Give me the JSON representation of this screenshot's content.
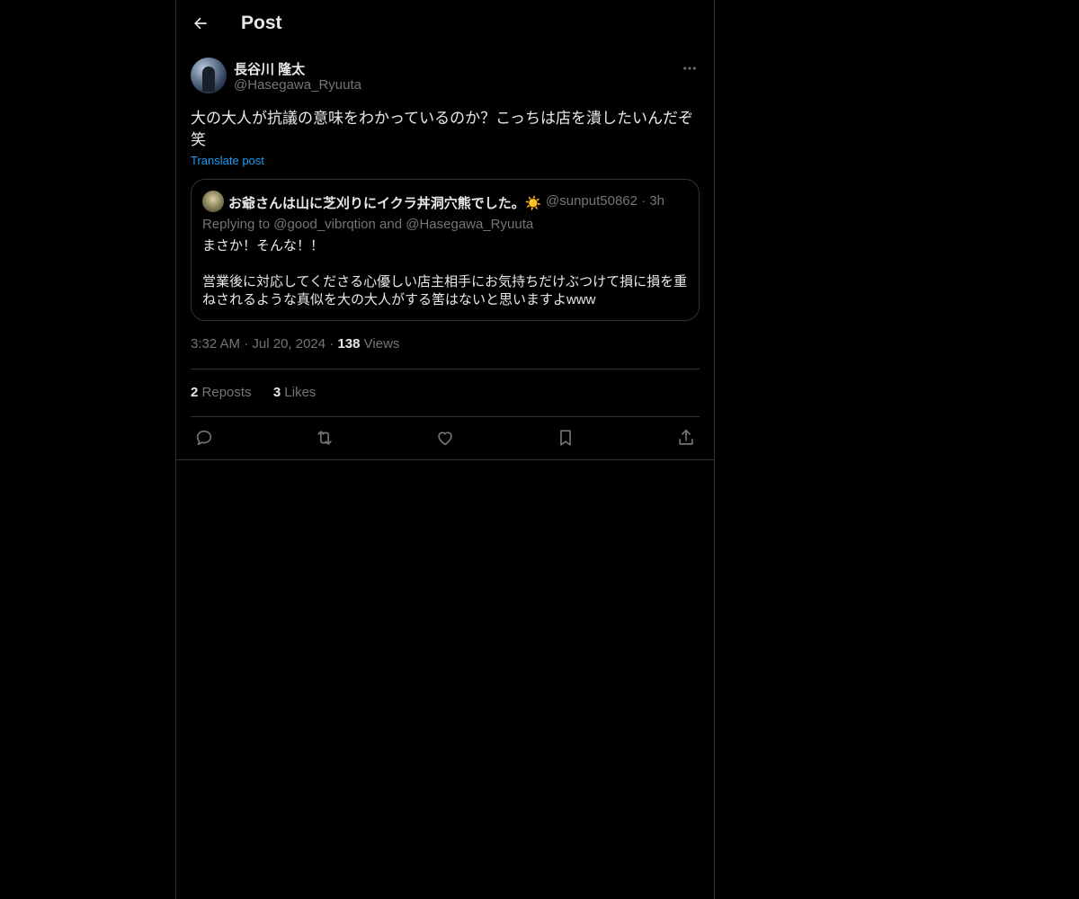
{
  "header": {
    "title": "Post",
    "back_icon": "arrow-left-icon"
  },
  "post": {
    "author_name": "長谷川 隆太",
    "author_handle": "@Hasegawa_Ryuuta",
    "text": "大の大人が抗議の意味をわかっているのか？こっちは店を潰したいんだぞ笑",
    "translate_label": "Translate post",
    "more_icon": "more-horizontal-icon",
    "quote": {
      "name": "お爺さんは山に芝刈りにイクラ丼洞穴熊でした。☀️",
      "handle": "@sunput50862",
      "time": "3h",
      "replying_prefix": "Replying to ",
      "replying_to_1": "@good_vibrqtion",
      "replying_and": " and ",
      "replying_to_2": "@Hasegawa_Ryuuta",
      "line1": "まさか！そんな！！",
      "line2": "営業後に対応してくださる心優しい店主相手にお気持ちだけぶつけて損に損を重",
      "line3": "ねされるような真似を大の大人がする筈はないと思いますよwww"
    },
    "time": "3:32 AM",
    "date": "Jul 20, 2024",
    "views_count": "138",
    "views_label": "Views",
    "reposts_count": "2",
    "reposts_label": "Reposts",
    "likes_count": "3",
    "likes_label": "Likes"
  },
  "actions": [
    {
      "name": "reply",
      "icon": "reply-icon"
    },
    {
      "name": "repost",
      "icon": "repost-icon"
    },
    {
      "name": "like",
      "icon": "heart-icon"
    },
    {
      "name": "bookmark",
      "icon": "bookmark-icon"
    },
    {
      "name": "share",
      "icon": "share-icon"
    }
  ],
  "colors": {
    "background": "#000000",
    "text_primary": "#e7e9ea",
    "text_secondary": "#71767b",
    "accent_link": "#1d9bf0",
    "border": "#2f3336"
  }
}
